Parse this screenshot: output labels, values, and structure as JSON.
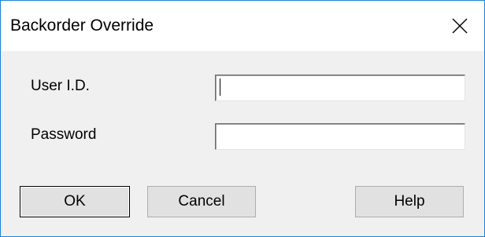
{
  "window": {
    "title": "Backorder Override"
  },
  "close_icon": "×",
  "fields": {
    "user_id_label": "User I.D.",
    "user_id_value": "",
    "password_label": "Password",
    "password_value": ""
  },
  "buttons": {
    "ok": "OK",
    "cancel": "Cancel",
    "help": "Help"
  },
  "colors": {
    "window_border": "#1883d7",
    "dialog_background": "#f0f0f0",
    "titlebar_background": "#ffffff",
    "button_face": "#e1e1e1"
  }
}
